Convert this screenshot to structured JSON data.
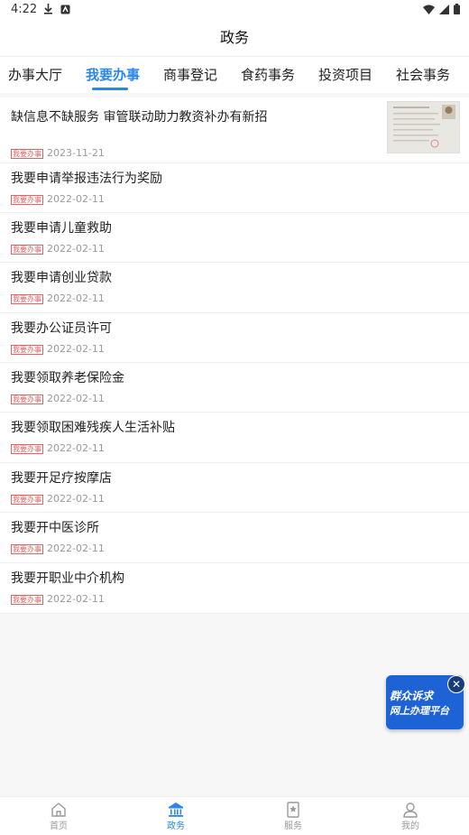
{
  "status": {
    "time": "4:22"
  },
  "header": {
    "title": "政务"
  },
  "tabs": [
    {
      "label": "办事大厅",
      "active": false
    },
    {
      "label": "我要办事",
      "active": true
    },
    {
      "label": "商事登记",
      "active": false
    },
    {
      "label": "食药事务",
      "active": false
    },
    {
      "label": "投资项目",
      "active": false
    },
    {
      "label": "社会事务",
      "active": false
    }
  ],
  "items": [
    {
      "title": "缺信息不缺服务  审管联动助力教资补办有新招",
      "tag": "我要办事",
      "date": "2023-11-21",
      "has_thumb": true
    },
    {
      "title": "我要申请举报违法行为奖励",
      "tag": "我要办事",
      "date": "2022-02-11"
    },
    {
      "title": "我要申请儿童救助",
      "tag": "我要办事",
      "date": "2022-02-11"
    },
    {
      "title": "我要申请创业贷款",
      "tag": "我要办事",
      "date": "2022-02-11"
    },
    {
      "title": "我要办公证员许可",
      "tag": "我要办事",
      "date": "2022-02-11"
    },
    {
      "title": "我要领取养老保险金",
      "tag": "我要办事",
      "date": "2022-02-11"
    },
    {
      "title": "我要领取困难残疾人生活补贴",
      "tag": "我要办事",
      "date": "2022-02-11"
    },
    {
      "title": "我要开足疗按摩店",
      "tag": "我要办事",
      "date": "2022-02-11"
    },
    {
      "title": "我要开中医诊所",
      "tag": "我要办事",
      "date": "2022-02-11"
    },
    {
      "title": "我要开职业中介机构",
      "tag": "我要办事",
      "date": "2022-02-11"
    }
  ],
  "banner": {
    "line1": "群众诉求",
    "line2": "网上办理平台"
  },
  "tabbar": [
    {
      "label": "首页",
      "icon": "home-icon",
      "active": false
    },
    {
      "label": "政务",
      "icon": "government-icon",
      "active": true
    },
    {
      "label": "服务",
      "icon": "service-icon",
      "active": false
    },
    {
      "label": "我的",
      "icon": "user-icon",
      "active": false
    }
  ],
  "colors": {
    "accent": "#2a87e8",
    "tag": "#e06464",
    "banner": "#1e63d6"
  }
}
